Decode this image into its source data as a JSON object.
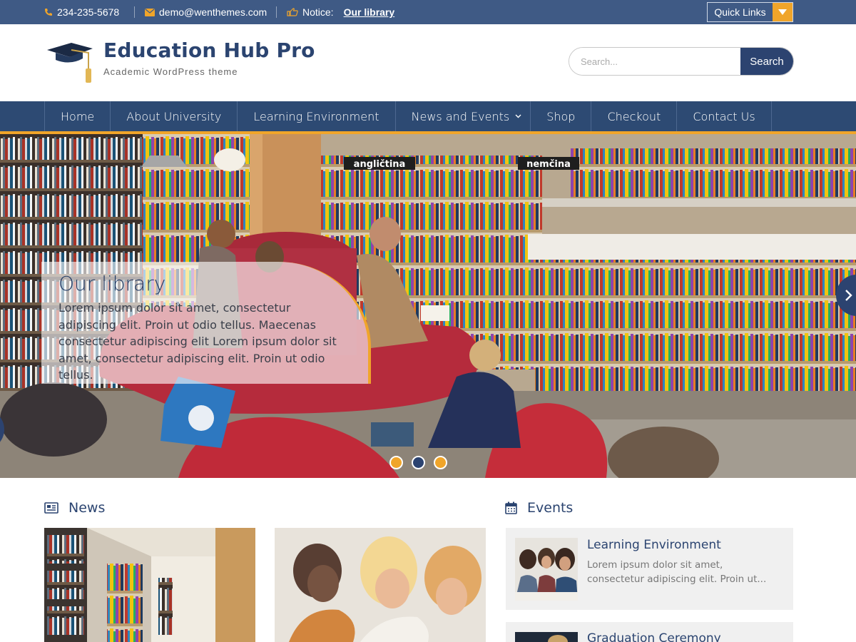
{
  "topbar": {
    "phone": "234-235-5678",
    "email": "demo@wenthemes.com",
    "notice_label": "Notice:",
    "notice_link": "Our library",
    "quick_links": "Quick Links"
  },
  "header": {
    "title": "Education Hub Pro",
    "tagline": "Academic WordPress theme",
    "search_placeholder": "Search...",
    "search_button": "Search"
  },
  "nav": {
    "items": [
      {
        "label": "Home"
      },
      {
        "label": "About University"
      },
      {
        "label": "Learning Environment"
      },
      {
        "label": "News and Events"
      },
      {
        "label": "Shop"
      },
      {
        "label": "Checkout"
      },
      {
        "label": "Contact Us"
      }
    ]
  },
  "hero": {
    "title": "Our library",
    "text": "Lorem ipsum dolor sit amet, consectetur adipiscing elit. Proin ut odio tellus. Maecenas consectetur adipiscing elit Lorem ipsum dolor sit amet, consectetur adipiscing elit. Proin ut odio tellus.",
    "sign_left": "angličtina",
    "sign_right": "nemčina",
    "active_slide": 2,
    "slide_count": 3
  },
  "news": {
    "heading": "News"
  },
  "events": {
    "heading": "Events",
    "items": [
      {
        "title": "Learning Environment",
        "excerpt": "Lorem ipsum dolor sit amet, consectetur adipiscing elit. Proin ut..."
      },
      {
        "title": "Graduation Ceremony",
        "excerpt": ""
      }
    ]
  },
  "colors": {
    "primary": "#2d4a73",
    "topbar": "#3f5a85",
    "accent": "#f0a52a"
  }
}
